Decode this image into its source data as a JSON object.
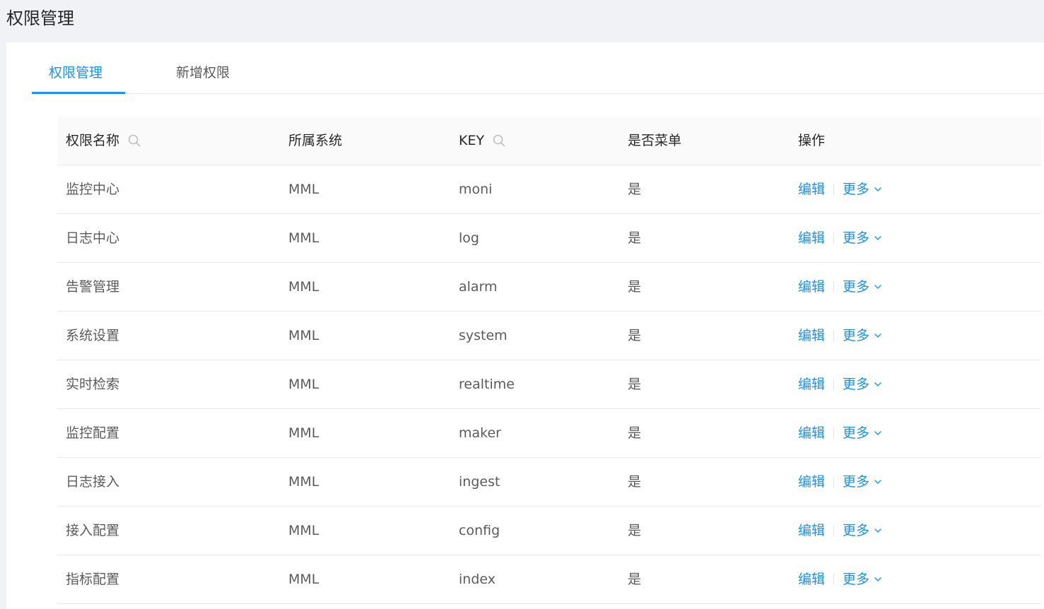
{
  "page": {
    "title": "权限管理"
  },
  "tabs": [
    {
      "label": "权限管理",
      "active": true
    },
    {
      "label": "新增权限",
      "active": false
    }
  ],
  "table": {
    "columns": [
      {
        "label": "权限名称",
        "searchable": true,
        "icon": "search-icon"
      },
      {
        "label": "所属系统",
        "searchable": false
      },
      {
        "label": "KEY",
        "searchable": true,
        "icon": "search-icon"
      },
      {
        "label": "是否菜单",
        "searchable": false
      },
      {
        "label": "操作",
        "searchable": false
      }
    ],
    "rows": [
      {
        "name": "监控中心",
        "system": "MML",
        "key": "moni",
        "is_menu": "是"
      },
      {
        "name": "日志中心",
        "system": "MML",
        "key": "log",
        "is_menu": "是"
      },
      {
        "name": "告警管理",
        "system": "MML",
        "key": "alarm",
        "is_menu": "是"
      },
      {
        "name": "系统设置",
        "system": "MML",
        "key": "system",
        "is_menu": "是"
      },
      {
        "name": "实时检索",
        "system": "MML",
        "key": "realtime",
        "is_menu": "是"
      },
      {
        "name": "监控配置",
        "system": "MML",
        "key": "maker",
        "is_menu": "是"
      },
      {
        "name": "日志接入",
        "system": "MML",
        "key": "ingest",
        "is_menu": "是"
      },
      {
        "name": "接入配置",
        "system": "MML",
        "key": "config",
        "is_menu": "是"
      },
      {
        "name": "指标配置",
        "system": "MML",
        "key": "index",
        "is_menu": "是"
      }
    ],
    "actions": {
      "edit_label": "编辑",
      "more_label": "更多",
      "more_icon": "chevron-down-icon"
    }
  },
  "colors": {
    "accent": "#1890ff",
    "background": "#f0f2f5",
    "border": "#e8e8e8",
    "header_bg": "#fafafa"
  }
}
